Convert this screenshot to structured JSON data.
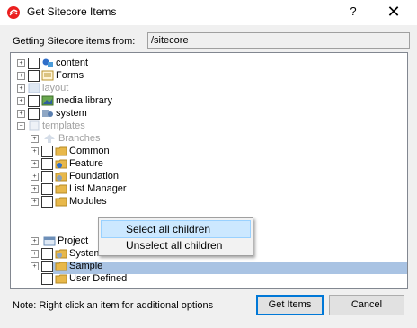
{
  "window": {
    "title": "Get Sitecore Items",
    "help": "?",
    "close": "✕"
  },
  "path": {
    "label": "Getting Sitecore items from:",
    "value": "/sitecore"
  },
  "tree": {
    "items": [
      {
        "label": "content",
        "icon": "content-icon",
        "disabled": false
      },
      {
        "label": "Forms",
        "icon": "forms-icon",
        "disabled": false
      },
      {
        "label": "layout",
        "icon": "layout-icon",
        "disabled": true
      },
      {
        "label": "media library",
        "icon": "media-library-icon",
        "disabled": false
      },
      {
        "label": "system",
        "icon": "system-icon",
        "disabled": false
      },
      {
        "label": "templates",
        "icon": "templates-icon",
        "disabled": true
      },
      {
        "label": "Branches",
        "icon": "branches-icon",
        "disabled": true
      },
      {
        "label": "Common",
        "icon": "folder-icon",
        "disabled": false
      },
      {
        "label": "Feature",
        "icon": "feature-icon",
        "disabled": false
      },
      {
        "label": "Foundation",
        "icon": "foundation-icon",
        "disabled": false
      },
      {
        "label": "List Manager",
        "icon": "folder-icon",
        "disabled": false
      },
      {
        "label": "Modules",
        "icon": "folder-icon",
        "disabled": false
      },
      {
        "label": "Project",
        "icon": "project-icon",
        "disabled": false,
        "selected": true
      },
      {
        "label": "System",
        "icon": "system-icon",
        "disabled": false
      },
      {
        "label": "Sample",
        "icon": "folder-icon",
        "disabled": false
      },
      {
        "label": "User Defined",
        "icon": "folder-icon",
        "disabled": false
      }
    ]
  },
  "context_menu": {
    "items": [
      {
        "label": "Select all children",
        "highlighted": true
      },
      {
        "label": "Unselect all children",
        "highlighted": false
      }
    ]
  },
  "footer": {
    "note": "Note: Right click an item for additional options",
    "get_items": "Get Items",
    "cancel": "Cancel"
  },
  "colors": {
    "selection": "#a9c3e3",
    "menu_highlight": "#cce8ff",
    "default_button_border": "#0078d7",
    "folder": "#e8b84a"
  }
}
